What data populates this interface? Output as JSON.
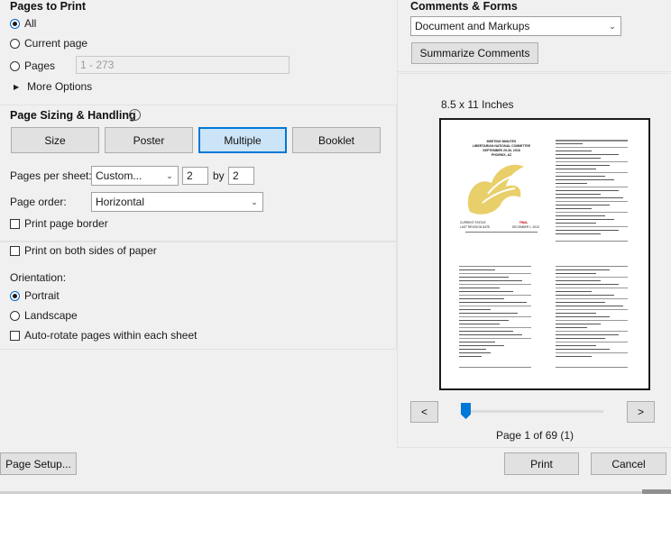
{
  "pages_to_print": {
    "header": "Pages to Print",
    "all_label": "All",
    "current_page_label": "Current page",
    "pages_label": "Pages",
    "pages_range_value": "1 - 273",
    "more_options_label": "More Options"
  },
  "comments_forms": {
    "header": "Comments & Forms",
    "selected": "Document and Markups",
    "summarize_label": "Summarize Comments"
  },
  "page_sizing": {
    "header": "Page Sizing & Handling",
    "tabs": [
      "Size",
      "Poster",
      "Multiple",
      "Booklet"
    ],
    "active_tab": "Multiple",
    "pages_per_sheet_label": "Pages per sheet:",
    "pages_per_sheet_value": "Custom...",
    "cols_value": "2",
    "by_label": "by",
    "rows_value": "2",
    "page_order_label": "Page order:",
    "page_order_value": "Horizontal",
    "print_border_label": "Print page border"
  },
  "duplex": {
    "both_sides_label": "Print on both sides of paper"
  },
  "orientation": {
    "header": "Orientation:",
    "portrait_label": "Portrait",
    "landscape_label": "Landscape",
    "selected": "Portrait",
    "auto_rotate_label": "Auto-rotate pages within each sheet"
  },
  "preview": {
    "paper_size": "8.5 x 11 Inches",
    "prev_label": "<",
    "next_label": ">",
    "page_status": "Page 1 of 69 (1)",
    "slider_position": 0.0,
    "thumb1_title_lines": [
      "MEETING MINUTES",
      "LIBERTARIAN NATIONAL COMMITTEE",
      "SEPTEMBER 29-30, 2018",
      "PHOENIX, AZ"
    ],
    "thumb1_footer": [
      "CURRENT STATUS",
      "LAST REVISION DATE",
      "FINAL",
      "DECEMBER 1, 2018"
    ]
  },
  "footer": {
    "page_setup_label": "Page Setup...",
    "print_label": "Print",
    "cancel_label": "Cancel"
  },
  "colors": {
    "accent": "#0078d7",
    "dialog_bg": "#f0f0f0",
    "logo_gold": "#e8cf6a"
  }
}
